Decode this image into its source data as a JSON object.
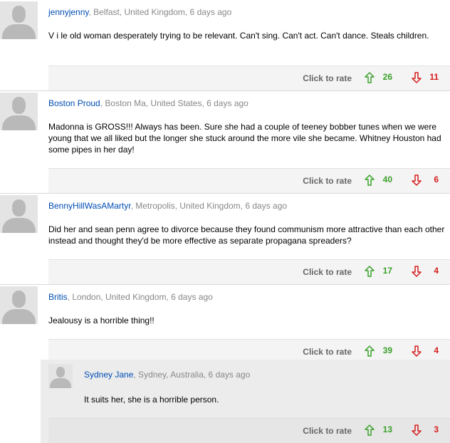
{
  "comments": [
    {
      "name": "jennyjenny",
      "location": ", Belfast, United Kingdom, 6 days ago",
      "text": "V i le old woman desperately trying to be relevant. Can't sing. Can't act. Can't dance. Steals children.",
      "rate_label": "Click to rate",
      "up": "26",
      "down": "11"
    },
    {
      "name": "Boston Proud",
      "location": ", Boston Ma, United States, 6 days ago",
      "text": "Madonna is GROSS!!! Always has been. Sure she had a couple of teeney bobber tunes when we were young that we all liked but the longer she stuck around the more vile she became. Whitney Houston had some pipes in her day!",
      "rate_label": "Click to rate",
      "up": "40",
      "down": "6"
    },
    {
      "name": "BennyHillWasAMartyr",
      "location": ", Metropolis, United Kingdom, 6 days ago",
      "text": "Did her and sean penn agree to divorce because they found communism more attractive than each other instead and thought they'd be more effective as separate propagana spreaders?",
      "rate_label": "Click to rate",
      "up": "17",
      "down": "4"
    },
    {
      "name": "Britis",
      "location": ", London, United Kingdom, 6 days ago",
      "text": "Jealousy is a horrible thing!!",
      "rate_label": "Click to rate",
      "up": "39",
      "down": "4"
    },
    {
      "name": "Sydney Jane",
      "location": ", Sydney, Australia, 6 days ago",
      "text": "It suits her, she is a horrible person.",
      "rate_label": "Click to rate",
      "up": "13",
      "down": "3"
    }
  ],
  "colors": {
    "name_link": "#004db3",
    "meta_grey": "#888888",
    "vote_up": "#3aa12a",
    "vote_down": "#d61c1c"
  },
  "icons": {
    "avatar": "default-avatar-icon",
    "up": "arrow-up-icon",
    "down": "arrow-down-icon"
  }
}
